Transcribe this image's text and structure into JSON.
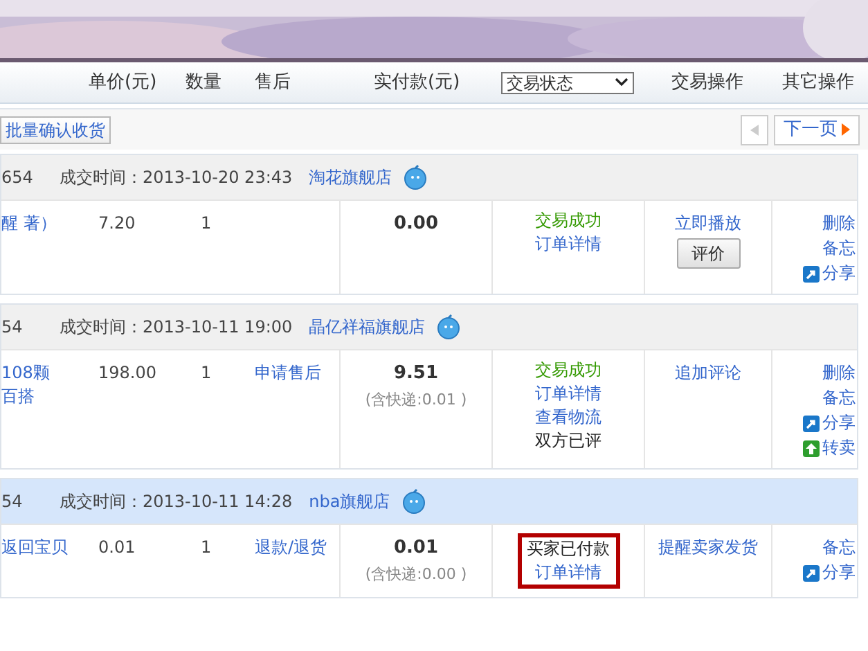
{
  "columns": {
    "price": "单价(元)",
    "qty": "数量",
    "after_sale": "售后",
    "paid": "实付款(元)",
    "status_filter": {
      "value": "交易状态"
    },
    "ops": "交易操作",
    "other": "其它操作"
  },
  "toolbar": {
    "batch_button": "批量确认收货",
    "prev_disabled": true,
    "next_button": "下一页"
  },
  "orders": [
    {
      "order_no": "654",
      "time_label": "成交时间：",
      "time": "2013-10-20 23:43",
      "shop": "淘花旗舰店",
      "highlighted": false,
      "item": [
        "醒 著）"
      ],
      "price": "7.20",
      "qty": "1",
      "paid": "0.00",
      "status": [
        {
          "text": "交易成功",
          "kind": "success"
        },
        {
          "text": "订单详情",
          "kind": "link"
        }
      ],
      "status_framed": false,
      "ops": [
        {
          "text": "立即播放",
          "kind": "link"
        },
        {
          "text": "评价",
          "kind": "button"
        }
      ],
      "other": [
        {
          "text": "删除",
          "kind": "link"
        },
        {
          "text": "备忘",
          "kind": "link"
        },
        {
          "text": "分享",
          "kind": "share"
        }
      ]
    },
    {
      "order_no": "54",
      "time_label": "成交时间：",
      "time": "2013-10-11 19:00",
      "shop": "晶亿祥福旗舰店",
      "highlighted": false,
      "item": [
        "108颗",
        "百搭"
      ],
      "price": "198.00",
      "qty": "1",
      "after_sale": [
        "申请售后"
      ],
      "paid": "9.51",
      "shipping": "(含快递:0.01 )",
      "status": [
        {
          "text": "交易成功",
          "kind": "success"
        },
        {
          "text": "订单详情",
          "kind": "link"
        },
        {
          "text": "查看物流",
          "kind": "link"
        },
        {
          "text": "双方已评",
          "kind": "plain"
        }
      ],
      "status_framed": false,
      "ops": [
        {
          "text": "追加评论",
          "kind": "link"
        }
      ],
      "other": [
        {
          "text": "删除",
          "kind": "link"
        },
        {
          "text": "备忘",
          "kind": "link"
        },
        {
          "text": "分享",
          "kind": "share"
        },
        {
          "text": "转卖",
          "kind": "resell"
        }
      ]
    },
    {
      "order_no": "54",
      "time_label": "成交时间：",
      "time": "2013-10-11 14:28",
      "shop": "nba旗舰店",
      "highlighted": true,
      "item": [
        "返回宝贝"
      ],
      "price": "0.01",
      "qty": "1",
      "after_sale": [
        "退款/退货"
      ],
      "paid": "0.01",
      "shipping": "(含快递:0.00 )",
      "status": [
        {
          "text": "买家已付款",
          "kind": "plain"
        },
        {
          "text": "订单详情",
          "kind": "link"
        }
      ],
      "status_framed": true,
      "ops": [
        {
          "text": "提醒卖家发货",
          "kind": "link"
        }
      ],
      "other": [
        {
          "text": "备忘",
          "kind": "link"
        },
        {
          "text": "分享",
          "kind": "share"
        }
      ]
    }
  ]
}
